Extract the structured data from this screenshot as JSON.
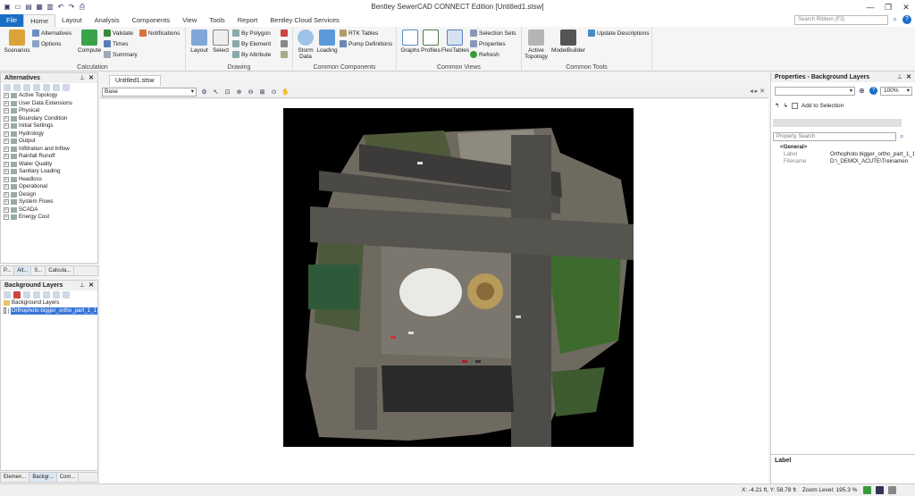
{
  "titlebar": {
    "title": "Bentley SewerCAD CONNECT Edition [Untitled1.stsw]",
    "min": "—",
    "max": "❐",
    "close": "✕"
  },
  "tabs": [
    "File",
    "Home",
    "Layout",
    "Analysis",
    "Components",
    "View",
    "Tools",
    "Report",
    "Bentley Cloud Services"
  ],
  "search_placeholder": "Search Ribbon (F3)",
  "ribbon": {
    "scenarios": "Scenarios",
    "alternatives": "Alternatives",
    "options": "Options",
    "compute": "Compute",
    "validate": "Validate",
    "times": "Times",
    "summary": "Summary",
    "notifications": "Notifications",
    "calculation": "Calculation",
    "layout": "Layout",
    "select": "Select",
    "by_polygon": "By Polygon",
    "by_element": "By Element",
    "by_attribute": "By Attribute",
    "drawing": "Drawing",
    "storm_data": "Storm Data",
    "loading": "Loading",
    "rtk_tables": "RTK Tables",
    "pump_definitions": "Pump Definitions",
    "common_components": "Common Components",
    "graphs": "Graphs",
    "profiles": "Profiles",
    "flextables": "FlexTables",
    "selection_sets": "Selection Sets",
    "properties": "Properties",
    "refresh": "Refresh",
    "common_views": "Common Views",
    "active_topology": "Active Topology",
    "modelbuilder": "ModelBuilder",
    "update_descriptions": "Update Descriptions",
    "common_tools": "Common Tools"
  },
  "alternatives_panel": {
    "title": "Alternatives",
    "items": [
      "Active Topology",
      "User Data Extensions",
      "Physical",
      "Boundary Condition",
      "Initial Settings",
      "Hydrology",
      "Output",
      "Infiltration and Inflow",
      "Rainfall Runoff",
      "Water Quality",
      "Sanitary Loading",
      "Headloss",
      "Operational",
      "Design",
      "System Flows",
      "SCADA",
      "Energy Cost"
    ],
    "tabs": [
      "P...",
      "Alt...",
      "S...",
      "Calcula..."
    ]
  },
  "background_panel": {
    "title": "Background Layers",
    "root": "Background Layers",
    "layer": "Orthophoto bigger_ortho_part_1_1"
  },
  "bottom_tabs": [
    "Elemen...",
    "Backgr...",
    "Com..."
  ],
  "document": {
    "tab": "Untitled1.stsw",
    "scenario_select": "Base"
  },
  "properties_panel": {
    "title": "Properties - Background Layers",
    "zoom": "100%",
    "add_to_selection": "Add to Selection",
    "search_placeholder": "Property Search",
    "category": "<General>",
    "rows": [
      {
        "key": "Label",
        "value": "Orthophoto bigger_ortho_part_1_1"
      },
      {
        "key": "Filename",
        "value": "D:\\_DEMO\\_ACUTE\\Treinamen"
      }
    ],
    "label_box": "Label"
  },
  "status": {
    "coords": "X: -4.21 ft, Y: 58.78 ft",
    "zoom": "Zoom Level: 195.3 %"
  }
}
